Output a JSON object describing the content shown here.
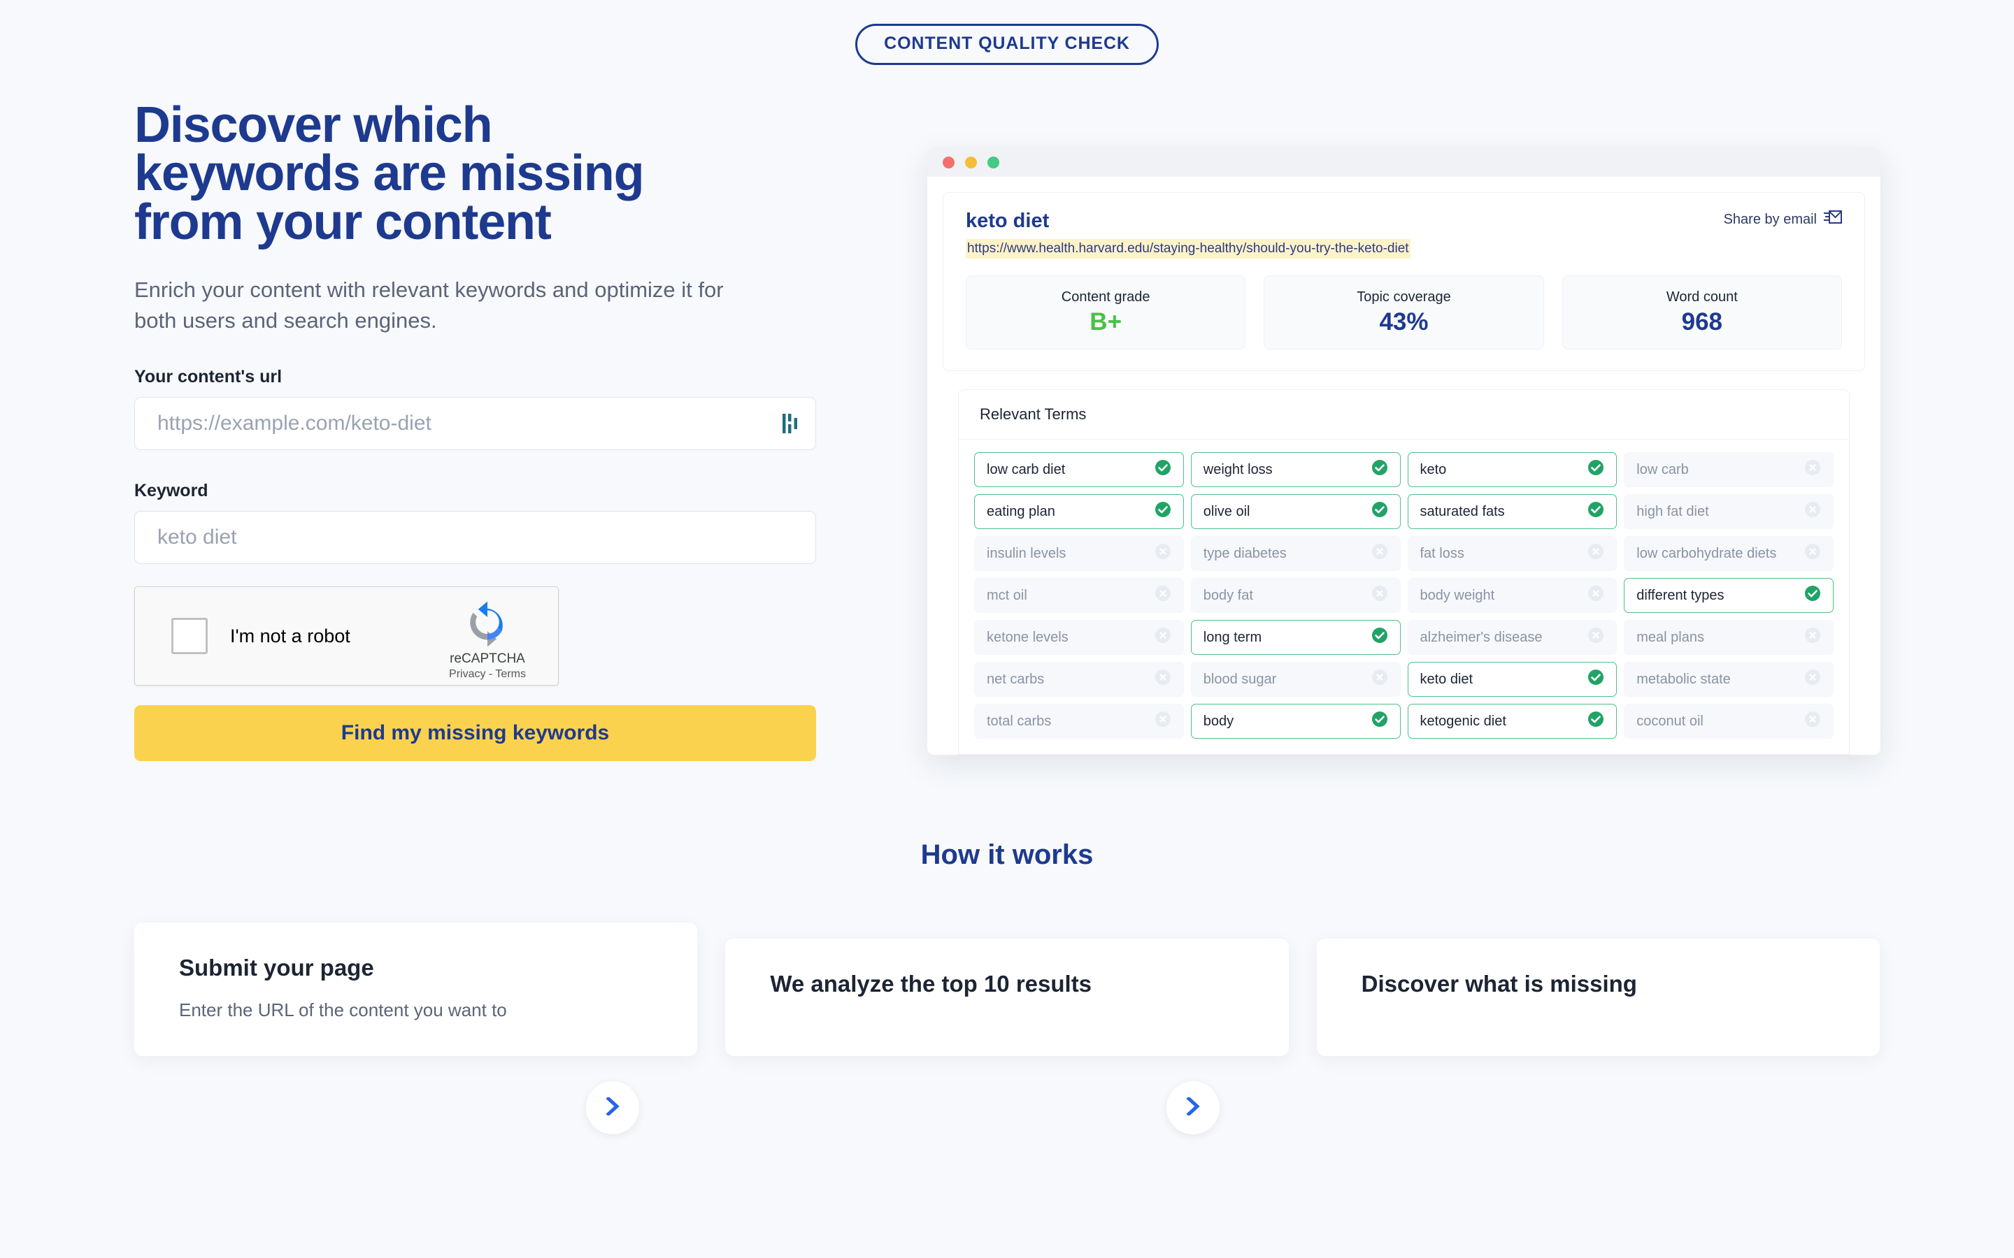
{
  "badge": {
    "label": "CONTENT QUALITY CHECK"
  },
  "hero": {
    "headline": "Discover which keywords are missing from your content",
    "subhead": "Enrich your content with relevant keywords and optimize it for both users and search engines.",
    "url_label": "Your content's url",
    "url_placeholder": "https://example.com/keto-diet",
    "url_icon": "logo-bars-icon",
    "keyword_label": "Keyword",
    "keyword_placeholder": "keto diet",
    "cta_label": "Find my missing keywords"
  },
  "recaptcha": {
    "label": "I'm not a robot",
    "brand": "reCAPTCHA",
    "terms": "Privacy - Terms",
    "icon": "recaptcha-icon"
  },
  "mockup": {
    "keyword": "keto diet",
    "share_label": "Share by email",
    "share_icon": "send-email-icon",
    "url": "https://www.health.harvard.edu/staying-healthy/should-you-try-the-keto-diet",
    "metrics": [
      {
        "label": "Content grade",
        "value": "B+",
        "kind": "grade"
      },
      {
        "label": "Topic coverage",
        "value": "43%",
        "kind": "number"
      },
      {
        "label": "Word count",
        "value": "968",
        "kind": "number"
      }
    ],
    "terms_title": "Relevant Terms",
    "terms": [
      {
        "label": "low carb diet",
        "covered": true
      },
      {
        "label": "weight loss",
        "covered": true
      },
      {
        "label": "keto",
        "covered": true
      },
      {
        "label": "low carb",
        "covered": false
      },
      {
        "label": "eating plan",
        "covered": true
      },
      {
        "label": "olive oil",
        "covered": true
      },
      {
        "label": "saturated fats",
        "covered": true
      },
      {
        "label": "high fat diet",
        "covered": false
      },
      {
        "label": "insulin levels",
        "covered": false
      },
      {
        "label": "type diabetes",
        "covered": false
      },
      {
        "label": "fat loss",
        "covered": false
      },
      {
        "label": "low carbohydrate diets",
        "covered": false
      },
      {
        "label": "mct oil",
        "covered": false
      },
      {
        "label": "body fat",
        "covered": false
      },
      {
        "label": "body weight",
        "covered": false
      },
      {
        "label": "different types",
        "covered": true
      },
      {
        "label": "ketone levels",
        "covered": false
      },
      {
        "label": "long term",
        "covered": true
      },
      {
        "label": "alzheimer's disease",
        "covered": false
      },
      {
        "label": "meal plans",
        "covered": false
      },
      {
        "label": "net carbs",
        "covered": false
      },
      {
        "label": "blood sugar",
        "covered": false
      },
      {
        "label": "keto diet",
        "covered": true
      },
      {
        "label": "metabolic state",
        "covered": false
      },
      {
        "label": "total carbs",
        "covered": false
      },
      {
        "label": "body",
        "covered": true
      },
      {
        "label": "ketogenic diet",
        "covered": true
      },
      {
        "label": "coconut oil",
        "covered": false
      }
    ]
  },
  "how": {
    "title": "How it works",
    "cards": [
      {
        "title": "Submit your page",
        "body": "Enter the URL of the content you want to"
      },
      {
        "title": "We analyze the top 10 results",
        "body": ""
      },
      {
        "title": "Discover what is missing",
        "body": ""
      }
    ],
    "connector_icon": "chevron-right-icon"
  },
  "colors": {
    "brand_blue": "#1e3a8f",
    "accent_yellow": "#fbd24e",
    "success_green": "#21a366",
    "grade_green": "#45c247",
    "highlight_yellow": "#fdf3c9",
    "teal": "#1f6f7c"
  }
}
